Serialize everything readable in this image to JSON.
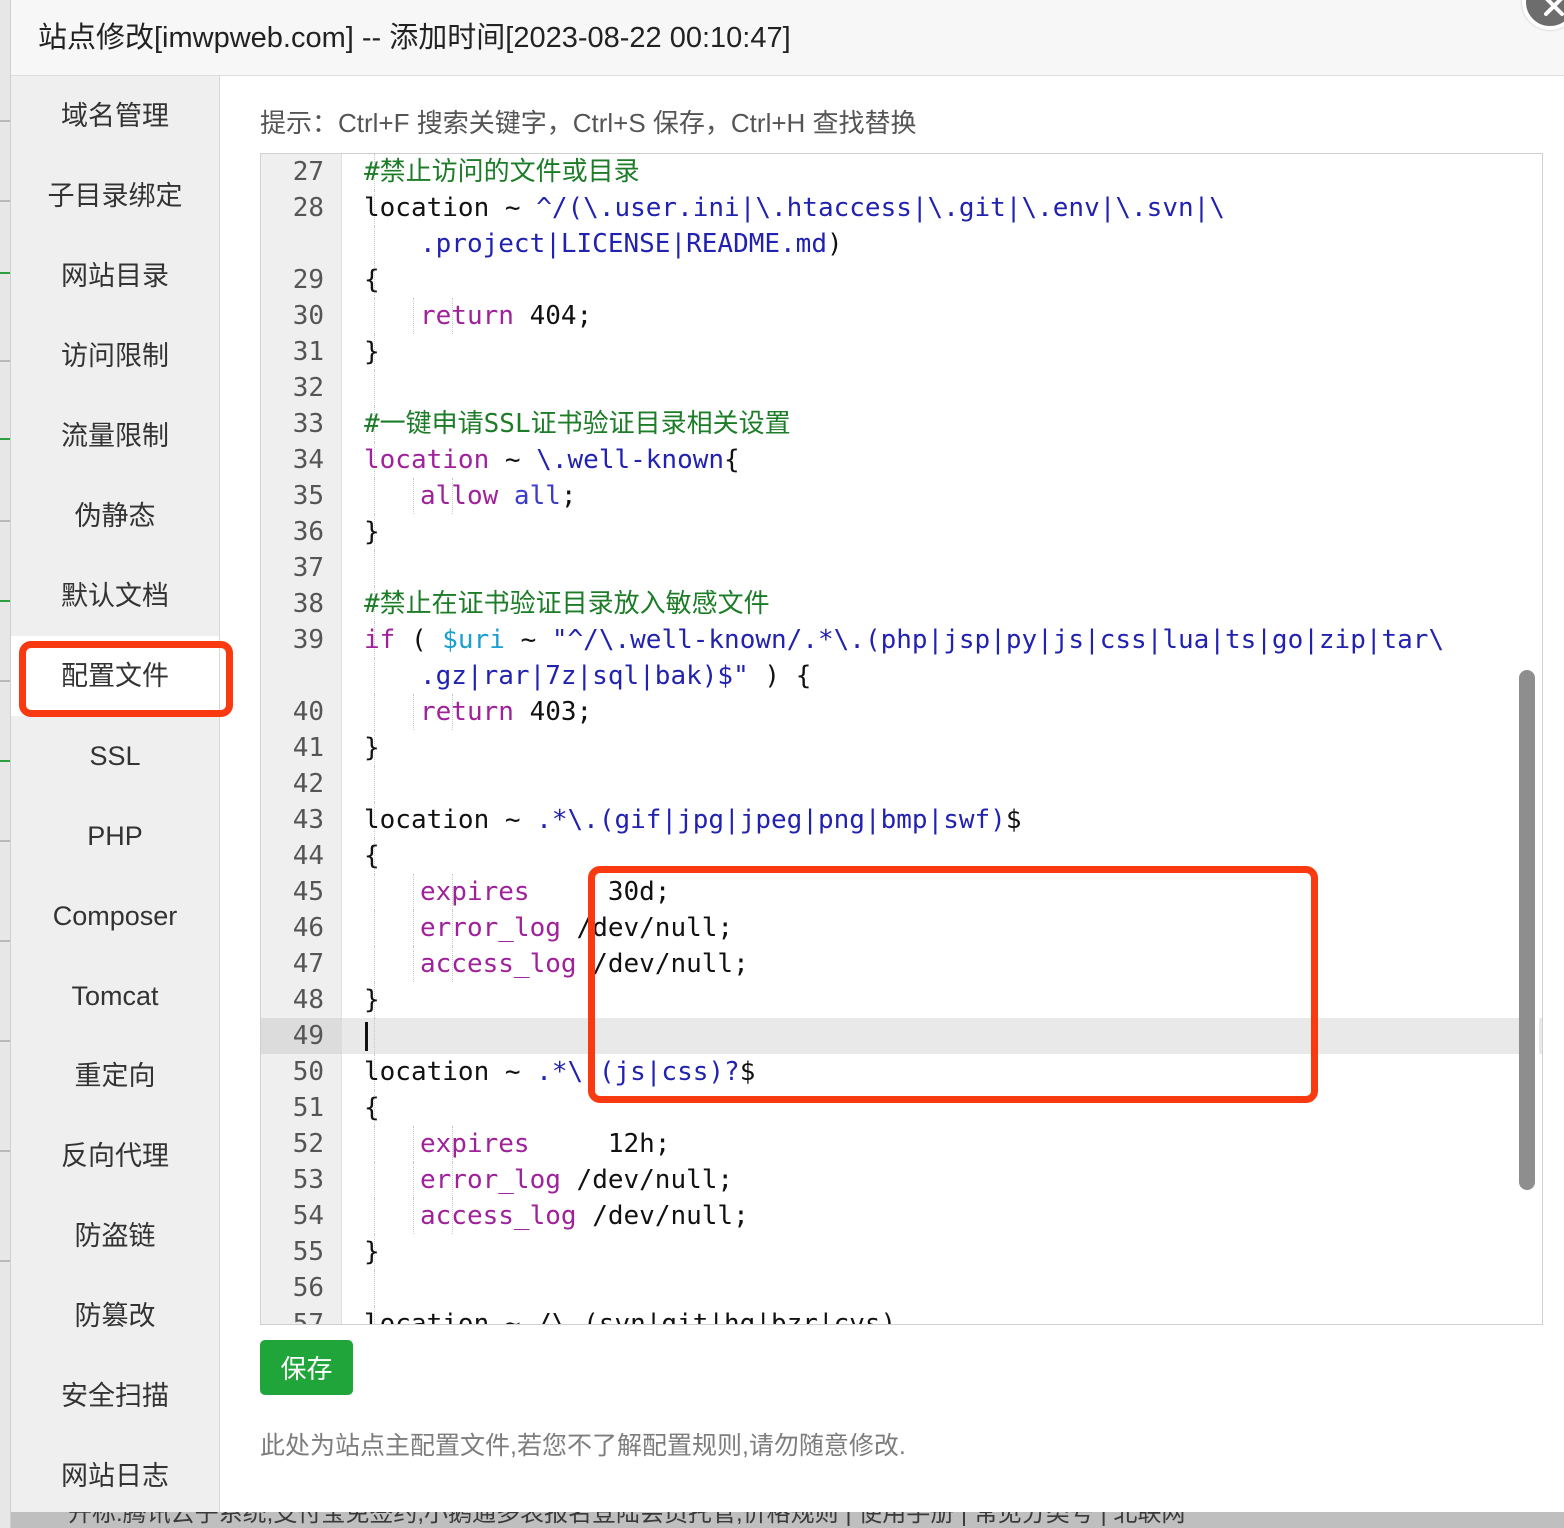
{
  "window": {
    "title": "站点修改[imwpweb.com] -- 添加时间[2023-08-22 00:10:47]",
    "close_icon": "close-x-icon"
  },
  "sidebar": {
    "items": [
      {
        "label": "域名管理",
        "active": false
      },
      {
        "label": "子目录绑定",
        "active": false
      },
      {
        "label": "网站目录",
        "active": false
      },
      {
        "label": "访问限制",
        "active": false
      },
      {
        "label": "流量限制",
        "active": false
      },
      {
        "label": "伪静态",
        "active": false
      },
      {
        "label": "默认文档",
        "active": false
      },
      {
        "label": "配置文件",
        "active": true
      },
      {
        "label": "SSL",
        "active": false
      },
      {
        "label": "PHP",
        "active": false
      },
      {
        "label": "Composer",
        "active": false
      },
      {
        "label": "Tomcat",
        "active": false
      },
      {
        "label": "重定向",
        "active": false
      },
      {
        "label": "反向代理",
        "active": false
      },
      {
        "label": "防盗链",
        "active": false
      },
      {
        "label": "防篡改",
        "active": false
      },
      {
        "label": "安全扫描",
        "active": false
      },
      {
        "label": "网站日志",
        "active": false
      }
    ]
  },
  "main": {
    "hint": "提示：Ctrl+F 搜索关键字，Ctrl+S 保存，Ctrl+H 查找替换",
    "save_label": "保存",
    "note": "此处为站点主配置文件,若您不了解配置规则,请勿随意修改.",
    "editor": {
      "first_visible_line": 27,
      "active_line": 49,
      "cursor_line": 49,
      "scroll_thumb_top_pct": 44,
      "lines": [
        {
          "num": "27",
          "indent": 0,
          "tokens": [
            {
              "t": "#禁止访问的文件或目录",
              "c": "c-comment"
            }
          ]
        },
        {
          "num": "28",
          "indent": 0,
          "tokens": [
            {
              "t": "location ",
              "c": "c-plain"
            },
            {
              "t": "~ ",
              "c": "c-plain"
            },
            {
              "t": "^/(\\.user.ini|\\.htaccess|\\.git|\\.env|\\.svn|\\",
              "c": "c-regex"
            }
          ]
        },
        {
          "num": "",
          "indent": 0,
          "wrap": true,
          "tokens": [
            {
              "t": ".project|LICENSE|README.md",
              "c": "c-regex"
            },
            {
              "t": ")",
              "c": "c-plain"
            }
          ]
        },
        {
          "num": "29",
          "indent": 0,
          "tokens": [
            {
              "t": "{",
              "c": "c-plain"
            }
          ]
        },
        {
          "num": "30",
          "indent": 2,
          "tokens": [
            {
              "t": "return ",
              "c": "c-kw"
            },
            {
              "t": "404;",
              "c": "c-plain"
            }
          ]
        },
        {
          "num": "31",
          "indent": 0,
          "tokens": [
            {
              "t": "}",
              "c": "c-plain"
            }
          ]
        },
        {
          "num": "32",
          "indent": 0,
          "tokens": []
        },
        {
          "num": "33",
          "indent": 0,
          "tokens": [
            {
              "t": "#一键申请SSL证书验证目录相关设置",
              "c": "c-comment"
            }
          ]
        },
        {
          "num": "34",
          "indent": 0,
          "tokens": [
            {
              "t": "location ",
              "c": "c-kw"
            },
            {
              "t": "~ ",
              "c": "c-plain"
            },
            {
              "t": "\\.well-known",
              "c": "c-regex"
            },
            {
              "t": "{",
              "c": "c-plain"
            }
          ]
        },
        {
          "num": "35",
          "indent": 2,
          "tokens": [
            {
              "t": "allow ",
              "c": "c-kw"
            },
            {
              "t": "all",
              "c": "c-blue"
            },
            {
              "t": ";",
              "c": "c-plain"
            }
          ]
        },
        {
          "num": "36",
          "indent": 0,
          "tokens": [
            {
              "t": "}",
              "c": "c-plain"
            }
          ]
        },
        {
          "num": "37",
          "indent": 0,
          "tokens": []
        },
        {
          "num": "38",
          "indent": 0,
          "tokens": [
            {
              "t": "#禁止在证书验证目录放入敏感文件",
              "c": "c-comment"
            }
          ]
        },
        {
          "num": "39",
          "indent": 0,
          "tokens": [
            {
              "t": "if ",
              "c": "c-kw"
            },
            {
              "t": "( ",
              "c": "c-plain"
            },
            {
              "t": "$uri ",
              "c": "c-var"
            },
            {
              "t": "~ ",
              "c": "c-plain"
            },
            {
              "t": "\"^/\\.well-known/.*\\.(php|jsp|py|js|css|lua|ts|go|zip|tar\\",
              "c": "c-str"
            }
          ]
        },
        {
          "num": "",
          "indent": 0,
          "wrap": true,
          "tokens": [
            {
              "t": ".gz|rar|7z|sql|bak)$\"",
              "c": "c-str"
            },
            {
              "t": " ) {",
              "c": "c-plain"
            }
          ]
        },
        {
          "num": "40",
          "indent": 2,
          "tokens": [
            {
              "t": "return ",
              "c": "c-kw"
            },
            {
              "t": "403;",
              "c": "c-plain"
            }
          ]
        },
        {
          "num": "41",
          "indent": 0,
          "tokens": [
            {
              "t": "}",
              "c": "c-plain"
            }
          ]
        },
        {
          "num": "42",
          "indent": 0,
          "tokens": []
        },
        {
          "num": "43",
          "indent": 0,
          "tokens": [
            {
              "t": "location ",
              "c": "c-plain"
            },
            {
              "t": "~ ",
              "c": "c-plain"
            },
            {
              "t": ".*\\.(gif|jpg|jpeg|png|bmp|swf)",
              "c": "c-regex"
            },
            {
              "t": "$",
              "c": "c-plain"
            }
          ]
        },
        {
          "num": "44",
          "indent": 0,
          "tokens": [
            {
              "t": "{",
              "c": "c-plain"
            }
          ]
        },
        {
          "num": "45",
          "indent": 2,
          "tokens": [
            {
              "t": "expires",
              "c": "c-kw"
            },
            {
              "t": "     30d;",
              "c": "c-plain"
            }
          ]
        },
        {
          "num": "46",
          "indent": 2,
          "tokens": [
            {
              "t": "error_log",
              "c": "c-kw"
            },
            {
              "t": " /dev/null;",
              "c": "c-plain"
            }
          ]
        },
        {
          "num": "47",
          "indent": 2,
          "tokens": [
            {
              "t": "access_log",
              "c": "c-kw"
            },
            {
              "t": " /dev/null;",
              "c": "c-plain"
            }
          ]
        },
        {
          "num": "48",
          "indent": 0,
          "tokens": [
            {
              "t": "}",
              "c": "c-plain"
            }
          ]
        },
        {
          "num": "49",
          "indent": 0,
          "active": true,
          "tokens": []
        },
        {
          "num": "50",
          "indent": 0,
          "tokens": [
            {
              "t": "location ",
              "c": "c-plain"
            },
            {
              "t": "~ ",
              "c": "c-plain"
            },
            {
              "t": ".*\\.(js|css)?",
              "c": "c-regex"
            },
            {
              "t": "$",
              "c": "c-plain"
            }
          ]
        },
        {
          "num": "51",
          "indent": 0,
          "tokens": [
            {
              "t": "{",
              "c": "c-plain"
            }
          ]
        },
        {
          "num": "52",
          "indent": 2,
          "tokens": [
            {
              "t": "expires",
              "c": "c-kw"
            },
            {
              "t": "     12h;",
              "c": "c-plain"
            }
          ]
        },
        {
          "num": "53",
          "indent": 2,
          "tokens": [
            {
              "t": "error_log",
              "c": "c-kw"
            },
            {
              "t": " /dev/null;",
              "c": "c-plain"
            }
          ]
        },
        {
          "num": "54",
          "indent": 2,
          "tokens": [
            {
              "t": "access_log",
              "c": "c-kw"
            },
            {
              "t": " /dev/null;",
              "c": "c-plain"
            }
          ]
        },
        {
          "num": "55",
          "indent": 0,
          "tokens": [
            {
              "t": "}",
              "c": "c-plain"
            }
          ]
        },
        {
          "num": "56",
          "indent": 0,
          "tokens": []
        },
        {
          "num": "57",
          "indent": 0,
          "clipped": true,
          "tokens": [
            {
              "t": "location ~ /\\.(svn|git|hg|bzr|cvs)",
              "c": "c-plain"
            }
          ]
        }
      ]
    }
  },
  "annotations": [
    {
      "name": "sidebar-config-file-highlight",
      "color": "#f93a10"
    },
    {
      "name": "code-image-location-block-highlight",
      "color": "#f93a10"
    }
  ],
  "bottom_strip": {
    "text": "开标:腾讯云子系统,支付宝免签约,小鹅通多表报名登陆会员托管,价格规则 | 使用手册 | 常见分类号 | 北联网"
  }
}
